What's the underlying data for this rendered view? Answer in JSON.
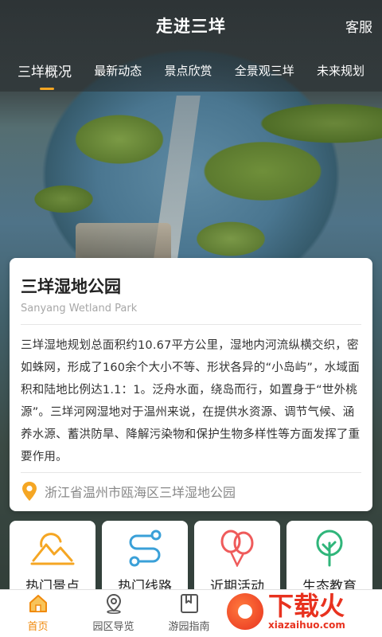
{
  "header": {
    "title": "走进三垟",
    "service_label": "客服"
  },
  "tabs": [
    {
      "label": "三垟概况",
      "active": true
    },
    {
      "label": "最新动态",
      "active": false
    },
    {
      "label": "景点欣赏",
      "active": false
    },
    {
      "label": "全景观三垟",
      "active": false
    },
    {
      "label": "未来规划",
      "active": false
    }
  ],
  "card": {
    "title": "三垟湿地公园",
    "subtitle": "Sanyang Wetland Park",
    "description": "三垟湿地规划总面积约10.67平方公里，湿地内河流纵横交织，密如蛛网，形成了160余个大小不等、形状各异的“小岛屿”，水域面积和陆地比例达1.1：1。泛舟水面，绕岛而行，如置身于“世外桃源”。三垟河网湿地对于温州来说，在提供水资源、调节气候、涵养水源、蓄洪防旱、降解污染物和保护生物多样性等方面发挥了重要作用。",
    "location": "浙江省温州市瓯海区三垟湿地公园",
    "location_icon": "map-pin-icon"
  },
  "quick_entries": [
    {
      "label": "热门景点",
      "icon": "mountain-sun-icon"
    },
    {
      "label": "热门线路",
      "icon": "route-icon"
    },
    {
      "label": "近期活动",
      "icon": "balloons-icon"
    },
    {
      "label": "生态教育",
      "icon": "tree-icon"
    }
  ],
  "bottom_nav": [
    {
      "label": "首页",
      "icon": "home-icon",
      "active": true
    },
    {
      "label": "园区导览",
      "icon": "location-icon",
      "active": false
    },
    {
      "label": "游园指南",
      "icon": "bookmark-icon",
      "active": false
    }
  ],
  "watermark": {
    "brand": "下载火",
    "url": "xiazaihuo.com"
  },
  "colors": {
    "accent": "#f5a623",
    "nav_active": "#f08a0c",
    "route_blue": "#3aa0d8",
    "balloon_red": "#ef5b5b",
    "tree_green": "#2fb57a",
    "watermark_red": "#e8321f"
  }
}
